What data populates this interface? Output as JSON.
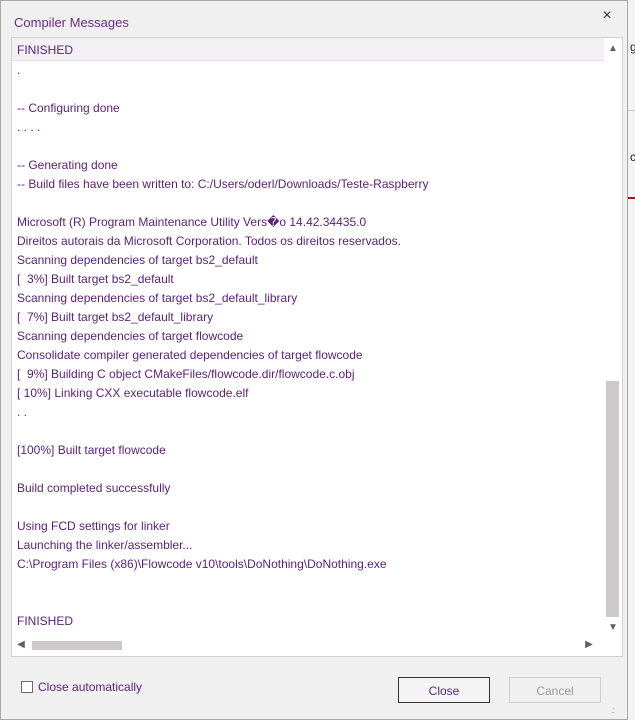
{
  "window": {
    "title": "Compiler Messages",
    "close_glyph": "×"
  },
  "log": {
    "header": "FINISHED",
    "lines": [
      ".",
      "",
      "-- Configuring done",
      ". . . .",
      "",
      "-- Generating done",
      "-- Build files have been written to: C:/Users/oderl/Downloads/Teste-Raspberry",
      "",
      "Microsoft (R) Program Maintenance Utility Vers�o 14.42.34435.0",
      "Direitos autorais da Microsoft Corporation. Todos os direitos reservados.",
      "Scanning dependencies of target bs2_default",
      "[  3%] Built target bs2_default",
      "Scanning dependencies of target bs2_default_library",
      "[  7%] Built target bs2_default_library",
      "Scanning dependencies of target flowcode",
      "Consolidate compiler generated dependencies of target flowcode",
      "[  9%] Building C object CMakeFiles/flowcode.dir/flowcode.c.obj",
      "[ 10%] Linking CXX executable flowcode.elf",
      ". .",
      "",
      "[100%] Built target flowcode",
      "",
      "Build completed successfully",
      "",
      "Using FCD settings for linker",
      "Launching the linker/assembler...",
      "C:\\Program Files (x86)\\Flowcode v10\\tools\\DoNothing\\DoNothing.exe",
      "",
      "",
      "FINISHED"
    ]
  },
  "scrollbars": {
    "up": "▲",
    "down": "▼",
    "left": "◀",
    "right": "▶"
  },
  "footer": {
    "close_auto_label": "Close automatically",
    "close_auto_checked": false,
    "close_button": "Close",
    "cancel_button": "Cancel",
    "grip": ".:"
  },
  "background": {
    "fragments": [
      "g",
      "c"
    ]
  },
  "colors": {
    "text": "#5a1f78",
    "title": "#6d2a83"
  }
}
